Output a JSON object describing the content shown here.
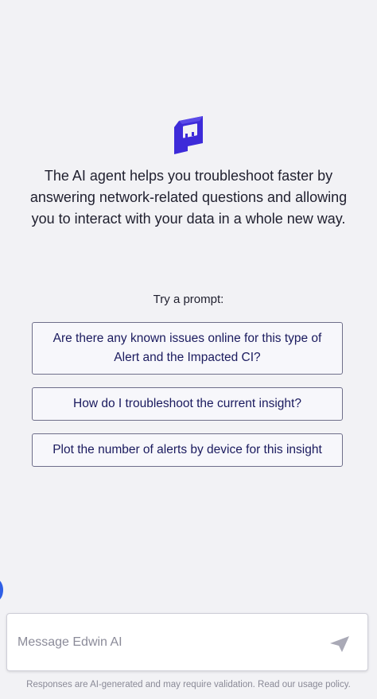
{
  "brand": {
    "logo_icon": "edwin-ai-logo-icon",
    "accent_color": "#3d2bd9"
  },
  "intro": {
    "text": "The AI agent helps you troubleshoot faster by answering network-related questions and allowing you to interact with your data in a whole new way."
  },
  "prompts": {
    "label": "Try a prompt:",
    "items": [
      {
        "label": "Are there any known issues online for this type of Alert and the Impacted CI?"
      },
      {
        "label": "How do I troubleshoot the current insight?"
      },
      {
        "label": "Plot the number of alerts by device for this insight"
      }
    ]
  },
  "composer": {
    "placeholder": "Message Edwin AI",
    "value": "",
    "send_icon": "send-icon"
  },
  "footer": {
    "disclaimer": "Responses are AI-generated and may require validation. Read our usage policy."
  }
}
